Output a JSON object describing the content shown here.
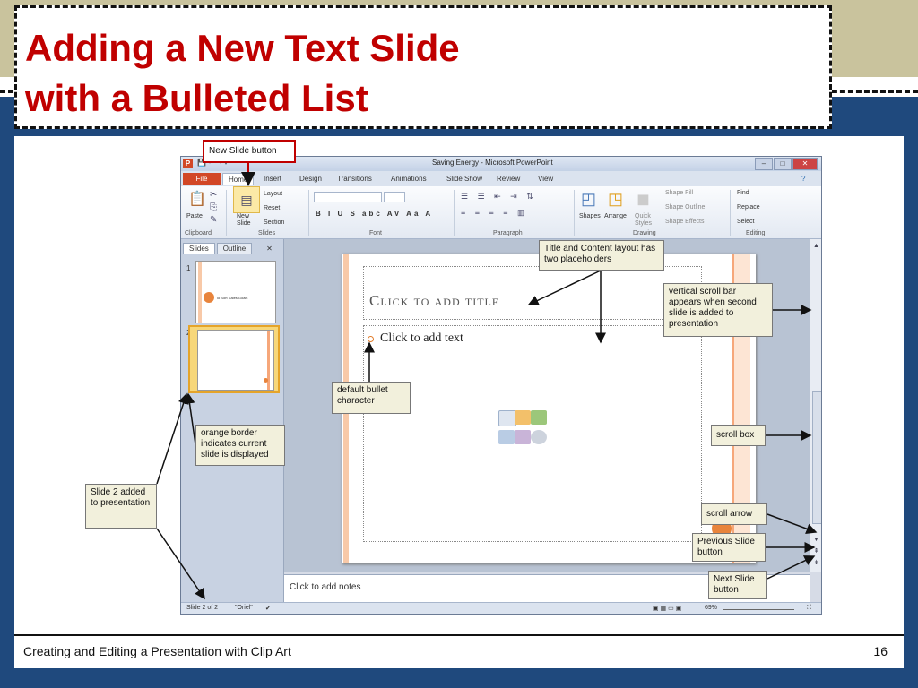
{
  "slide": {
    "title_line1": "Adding a New Text Slide",
    "title_line2": "with a Bulleted List",
    "footer": "Creating and Editing a Presentation with Clip Art",
    "page_number": "16"
  },
  "colors": {
    "title_red": "#c00000",
    "frame_blue": "#1f497d",
    "band_tan": "#c9c39d",
    "callout_bg": "#f2f0dc",
    "ppt_orange": "#d24726"
  },
  "ppt": {
    "window_title": "Saving Energy - Microsoft PowerPoint",
    "tabs": [
      "File",
      "Home",
      "Insert",
      "Design",
      "Transitions",
      "Animations",
      "Slide Show",
      "Review",
      "View"
    ],
    "ribbon": {
      "paste": "Paste",
      "new_slide": "New Slide",
      "layout": "Layout",
      "reset": "Reset",
      "section": "Section",
      "font_buttons": "B I U S abc AV Aa A",
      "shapes": "Shapes",
      "arrange": "Arrange",
      "quick_styles": "Quick Styles",
      "shape_fill": "Shape Fill",
      "shape_outline": "Shape Outline",
      "shape_effects": "Shape Effects",
      "find": "Find",
      "replace": "Replace",
      "select": "Select",
      "groups": {
        "clipboard": "Clipboard",
        "slides": "Slides",
        "font": "Font",
        "paragraph": "Paragraph",
        "drawing": "Drawing",
        "editing": "Editing"
      }
    },
    "sidebar": {
      "tab_slides": "Slides",
      "tab_outline": "Outline",
      "thumb1_num": "1",
      "thumb2_num": "2",
      "thumb1_text": "To Sort Sales Goals"
    },
    "placeholders": {
      "title": "Click to add title",
      "body": "Click to add text"
    },
    "notes": "Click to add notes",
    "status": {
      "slide": "Slide 2 of 2",
      "theme": "\"Oriel\"",
      "zoom": "69%"
    }
  },
  "callouts": {
    "new_slide_button": "New Slide button",
    "layout": "Title and Content layout has two placeholders",
    "vscroll": "vertical scroll bar appears when second slide is added to presentation",
    "bullet": "default bullet character",
    "orange_border": "orange border indicates current slide is displayed",
    "slide2": "Slide 2 added to presentation",
    "scroll_box": "scroll box",
    "scroll_arrow": "scroll arrow",
    "prev_slide": "Previous Slide button",
    "next_slide": "Next Slide button"
  }
}
